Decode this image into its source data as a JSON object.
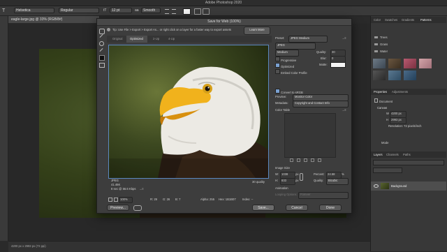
{
  "app": {
    "title": "Adobe Photoshop 2020"
  },
  "options_bar": {
    "font_family": "Helvetica",
    "font_style": "Regular",
    "font_size": "12 pt",
    "antialias": "Smooth"
  },
  "document": {
    "tab": "eagle-large.jpg @ 33% (RGB/8#)",
    "status": "4200 px x 2993 px (72 ppi)"
  },
  "dialog": {
    "title": "Save for Web (100%)",
    "tip": "Tip: Use File > Export > Export As... or right click on a layer for a faster way to export assets",
    "learn_more": "Learn More",
    "tabs": [
      "Original",
      "Optimized",
      "2-Up",
      "4-Up"
    ],
    "preview_info": {
      "format": "JPEG",
      "size": "41.46K",
      "time": "8 sec @ 56.6 Kbps",
      "menu": "→≡",
      "quality": "30 quality"
    },
    "preset_label": "Preset:",
    "preset_value": "JPEG Medium",
    "format_value": "JPEG",
    "compression_value": "Medium",
    "quality_label": "Quality:",
    "quality_value": "30",
    "blur_label": "Blur:",
    "blur_value": "0",
    "matte_label": "Matte:",
    "progressive_label": "Progressive",
    "optimized_label": "Optimized",
    "embed_label": "Embed Color Profile",
    "convert_label": "Convert to sRGB",
    "preview_label": "Preview:",
    "preview_value": "Monitor Color",
    "metadata_label": "Metadata:",
    "metadata_value": "Copyright and Contact Info",
    "color_table_label": "Color Table",
    "image_size_label": "Image Size",
    "w_label": "W:",
    "w_value": "1038",
    "h_label": "H:",
    "h_value": "833",
    "px_unit": "px",
    "percent_label": "Percent:",
    "percent_value": "24.58",
    "percent_unit": "%",
    "quality_resample_label": "Quality:",
    "quality_resample_value": "Bicubic",
    "animation_label": "Animation",
    "looping_label": "Looping Options:",
    "looping_value": "Forever",
    "bottom_stats": {
      "zoom": "100%",
      "r": "R: 29",
      "g": "G: 26",
      "b": "B: 7",
      "alpha": "Alpha: 255",
      "hex": "Hex: 1B1B07",
      "index": "Index: --"
    },
    "buttons": {
      "preview": "Preview...",
      "save": "Save...",
      "cancel": "Cancel",
      "done": "Done"
    }
  },
  "right_panels": {
    "tabs_top": [
      "Color",
      "Swatches",
      "Gradients",
      "Patterns"
    ],
    "patterns": [
      "Trees",
      "Grass",
      "Water"
    ],
    "properties_tabs": [
      "Properties",
      "Adjustments"
    ],
    "properties_document": "Document",
    "canvas_label": "Canvas",
    "canvas_w": "4200 px",
    "canvas_h": "2993 px",
    "canvas_w_label": "W",
    "canvas_h_label": "H",
    "resolution": "Resolution: 72 pixels/inch",
    "mode_label": "Mode",
    "layers_tabs": [
      "Layers",
      "Channels",
      "Paths"
    ],
    "layer_name": "Background"
  }
}
